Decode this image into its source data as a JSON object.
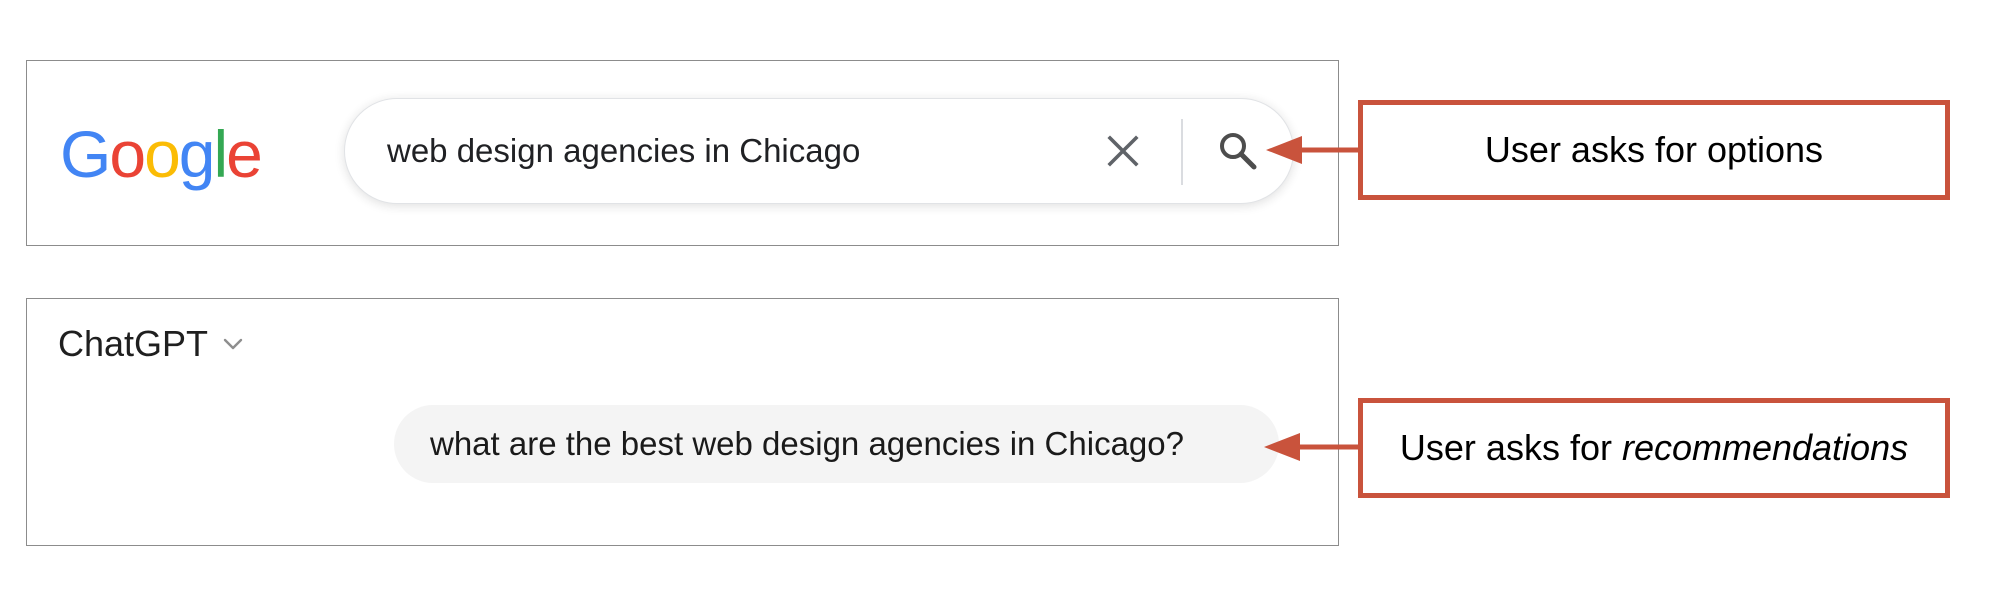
{
  "google": {
    "logo_letters": [
      {
        "char": "G",
        "color": "#4285F4"
      },
      {
        "char": "o",
        "color": "#EA4335"
      },
      {
        "char": "o",
        "color": "#FBBC05"
      },
      {
        "char": "g",
        "color": "#4285F4"
      },
      {
        "char": "l",
        "color": "#34A853"
      },
      {
        "char": "e",
        "color": "#EA4335"
      }
    ],
    "search_query": "web design agencies in Chicago",
    "clear_icon": "close-icon",
    "search_icon": "search-icon"
  },
  "chatgpt": {
    "model_label": "ChatGPT",
    "model_icon": "chevron-down-icon",
    "user_message": "what are the best web design agencies in Chicago?"
  },
  "annotations": {
    "options": {
      "text": "User asks for options"
    },
    "recommendations": {
      "text_prefix": "User asks for",
      "text_emphasis": "recommendations"
    },
    "accent_color": "#C9533C"
  }
}
